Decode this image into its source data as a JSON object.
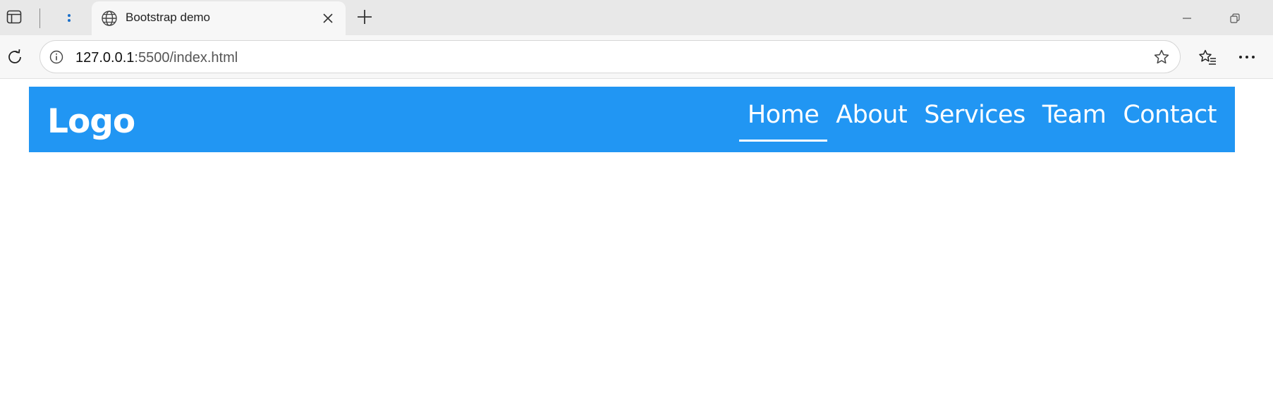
{
  "browser": {
    "active_tab": {
      "title": "Bootstrap demo"
    },
    "address_bar": {
      "host": "127.0.0.1",
      "path": ":5500/index.html"
    }
  },
  "page": {
    "navbar": {
      "background": "#2196f3",
      "brand": "Logo",
      "links": [
        {
          "label": "Home",
          "active": true
        },
        {
          "label": "About"
        },
        {
          "label": "Services"
        },
        {
          "label": "Team"
        },
        {
          "label": "Contact"
        }
      ]
    }
  },
  "icons": {
    "tab_actions": "tab-actions-icon",
    "pinned_tab": "pinned-tab-icon",
    "favicon": "globe-icon",
    "close": "close-icon",
    "new_tab": "plus-icon",
    "minimize": "minimize-icon",
    "restore": "restore-icon",
    "reload": "reload-icon",
    "site_info": "info-icon",
    "favorite": "star-icon",
    "favorites": "favorites-icon",
    "more": "more-icon"
  }
}
